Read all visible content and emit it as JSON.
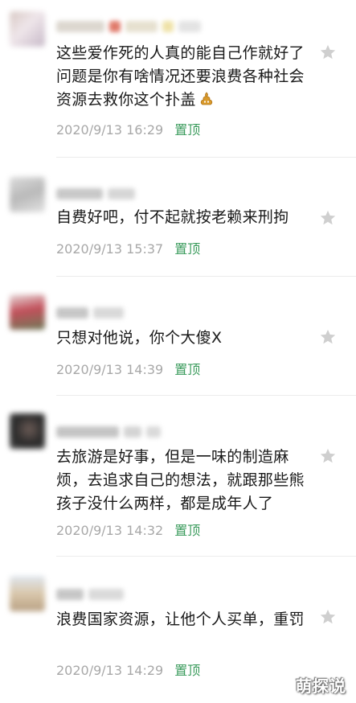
{
  "comments": [
    {
      "text": "这些爱作死的人真的能自己作就好了 问题是你有啥情况还要浪费各种社会资源去救你这个扑盖",
      "emoji": "poop-icon",
      "time": "2020/9/13 16:29",
      "pin_label": "置顶"
    },
    {
      "text": "自费好吧，付不起就按老赖来刑拘",
      "time": "2020/9/13 15:37",
      "pin_label": "置顶"
    },
    {
      "text": "只想对他说，你个大傻X",
      "time": "2020/9/13 14:39",
      "pin_label": "置顶"
    },
    {
      "text": "去旅游是好事，但是一味的制造麻烦，去追求自己的想法，就跟那些熊孩子没什么两样，都是成年人了",
      "time": "2020/9/13 14:32",
      "pin_label": "置顶"
    },
    {
      "text": "浪费国家资源，让他个人买单，重罚",
      "time": "2020/9/13 14:29",
      "pin_label": "置顶"
    }
  ],
  "watermark": "萌探说",
  "colors": {
    "text": "#191919",
    "meta": "#a8a8a8",
    "pin": "#3a9b5c",
    "star": "#cfcfcf"
  }
}
